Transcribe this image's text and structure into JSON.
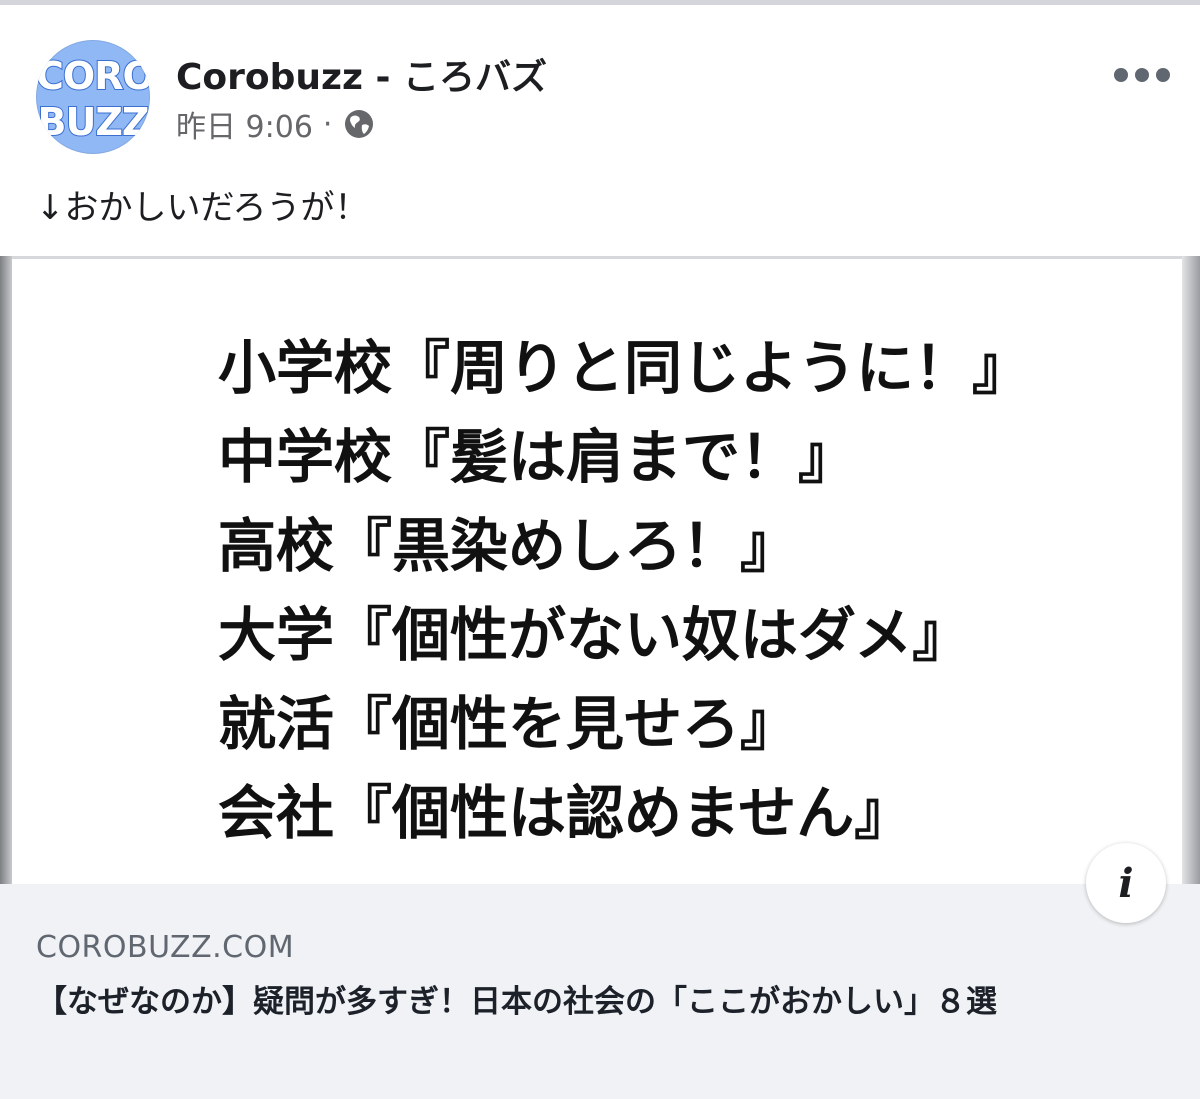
{
  "post": {
    "author": "Corobuzz - ころバズ",
    "avatar_logo": [
      "CORO",
      "BUZZ"
    ],
    "time": "昨日 9:06",
    "separator": "·",
    "privacy_icon": "globe-icon",
    "menu_icon": "more-horizontal-icon",
    "text": "↓おかしいだろうが！"
  },
  "image": {
    "lines": [
      "小学校『周りと同じように！』",
      "中学校『髪は肩まで！』",
      "高校『黒染めしろ！』",
      "大学『個性がない奴はダメ』",
      "就活『個性を見せろ』",
      "会社『個性は認めません』"
    ],
    "info_icon": "i"
  },
  "link": {
    "domain": "COROBUZZ.COM",
    "title": "【なぜなのか】疑問が多すぎ！日本の社会の「ここがおかしい」８選"
  },
  "colors": {
    "avatar_bg": "#8fb8f5",
    "logo_stroke": "#3b6fd0",
    "card_bg": "#f0f2f5",
    "secondary_text": "#65676b"
  }
}
